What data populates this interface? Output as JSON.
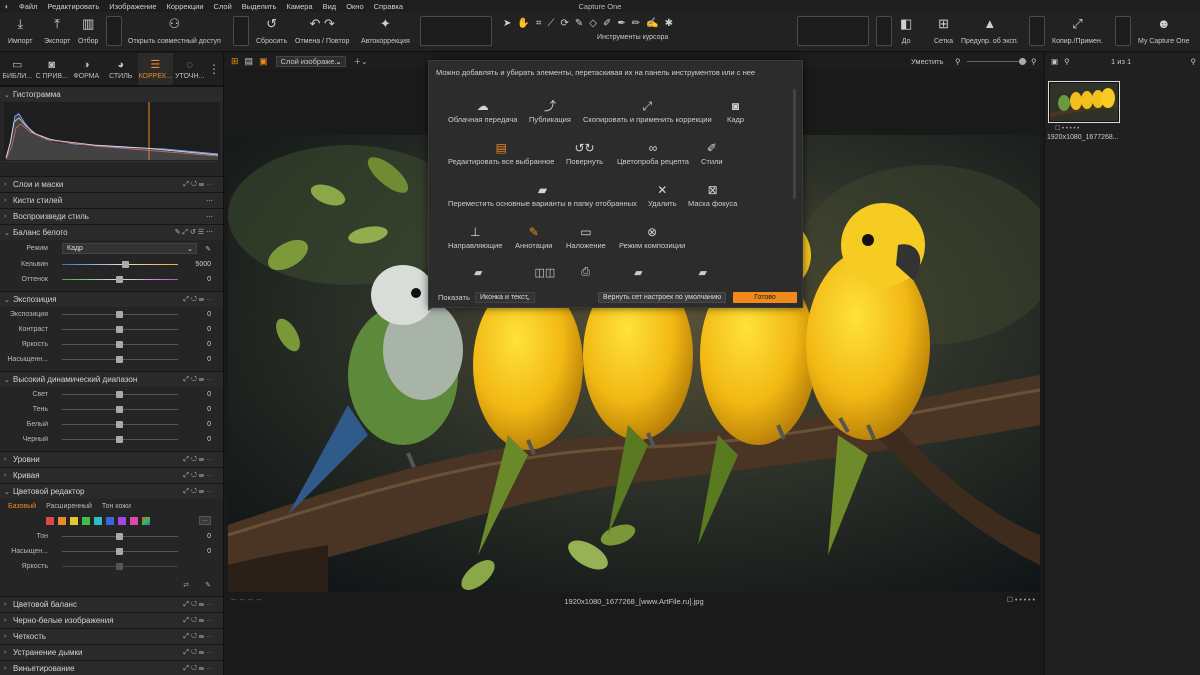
{
  "menubar": {
    "items": [
      "Файл",
      "Редактировать",
      "Изображение",
      "Коррекции",
      "Слой",
      "Выделить",
      "Камера",
      "Вид",
      "Окно",
      "Справка"
    ],
    "app_title": "Capture One"
  },
  "toolbar": {
    "import": "Импорт",
    "export": "Экспорт",
    "select": "Отбор",
    "share": "Открыть совместный доступ",
    "reset": "Сбросить",
    "undo_redo": "Отмена / Повтор",
    "auto": "Автокоррекция",
    "cursor_tools": "Инструменты курсора",
    "before": "До",
    "grid": "Сетка",
    "exposure_warn": "Предупр. об эксп.",
    "copy_apply": "Копир./Примен.",
    "my_c1": "My Capture One"
  },
  "tabs": [
    "БИБЛИ...",
    "С ПРИВ...",
    "ФОРМА",
    "СТИЛЬ",
    "КОРРЕК...",
    "УТОЧН..."
  ],
  "left": {
    "histogram": "Гистограмма",
    "layers": "Слои и маски",
    "style_brushes": "Кисти стилей",
    "replay_style": "Воспроизведи стиль",
    "wb": "Баланс белого",
    "wb_mode_label": "Режим",
    "wb_mode_value": "Кадр",
    "kelvin_label": "Кельвин",
    "kelvin_value": "5000",
    "tint_label": "Оттенок",
    "tint_value": "0",
    "exposure": "Экспозиция",
    "exp_rows": [
      {
        "label": "Экспозиция",
        "value": "0"
      },
      {
        "label": "Контраст",
        "value": "0"
      },
      {
        "label": "Яркость",
        "value": "0"
      },
      {
        "label": "Насыщенн...",
        "value": "0"
      }
    ],
    "hdr": "Высокий динамический диапазон",
    "hdr_rows": [
      {
        "label": "Свет",
        "value": "0"
      },
      {
        "label": "Тень",
        "value": "0"
      },
      {
        "label": "Белый",
        "value": "0"
      },
      {
        "label": "Черный",
        "value": "0"
      }
    ],
    "levels": "Уровни",
    "curve": "Кривая",
    "color_editor": "Цветовой редактор",
    "ce_tabs": [
      "Базовый",
      "Расширенный",
      "Тон кожи"
    ],
    "ce_rows": [
      {
        "label": "Тон",
        "value": "0"
      },
      {
        "label": "Насыщен...",
        "value": "0"
      },
      {
        "label": "Яркость",
        "value": ""
      }
    ],
    "color_balance": "Цветовой баланс",
    "bw": "Черно-белые изображения",
    "clarity": "Четкость",
    "dehaze": "Устранение дымки",
    "vignette": "Виньетирование"
  },
  "viewer": {
    "layer_select": "Слой изображе...",
    "fit": "Уместить",
    "caption": "1920x1080_1677268_[www.ArtFile.ru].jpg"
  },
  "right": {
    "count": "1 из 1",
    "thumb_name": "1920x1080_1677268..."
  },
  "popup": {
    "hint": "Можно добавлять и убирать элементы, перетаскивая их на панель инструментов или с нее",
    "items": [
      {
        "label": "Облачная передача",
        "icon": "cloud-upload-icon"
      },
      {
        "label": "Публикация",
        "icon": "publish-icon"
      },
      {
        "label": "Скопировать и применить коррекции",
        "icon": "copy-apply-icon"
      },
      {
        "label": "Кадр",
        "icon": "camera-icon"
      },
      {
        "label": "Редактировать все выбранное",
        "icon": "edit-all-icon"
      },
      {
        "label": "Повернуть",
        "icon": "rotate-icon"
      },
      {
        "label": "Цветопроба рецепта",
        "icon": "proof-icon"
      },
      {
        "label": "Стили",
        "icon": "styles-icon"
      },
      {
        "label": "Переместить основные варианты в папку отобранных",
        "icon": "move-icon"
      },
      {
        "label": "Удалить",
        "icon": "delete-icon"
      },
      {
        "label": "Маска фокуса",
        "icon": "focus-mask-icon"
      },
      {
        "label": "Направляющие",
        "icon": "guides-icon"
      },
      {
        "label": "Аннотации",
        "icon": "annotations-icon"
      },
      {
        "label": "Наложение",
        "icon": "overlay-icon"
      },
      {
        "label": "Режим композиции",
        "icon": "composition-icon"
      }
    ],
    "show_label": "Показать",
    "show_value": "Иконка и текст",
    "reset_default": "Вернуть сет настроек по умолчанию",
    "done": "Готово"
  },
  "colors": {
    "accent": "#f08a1c",
    "panel": "#252525",
    "toolbar": "#222222"
  }
}
